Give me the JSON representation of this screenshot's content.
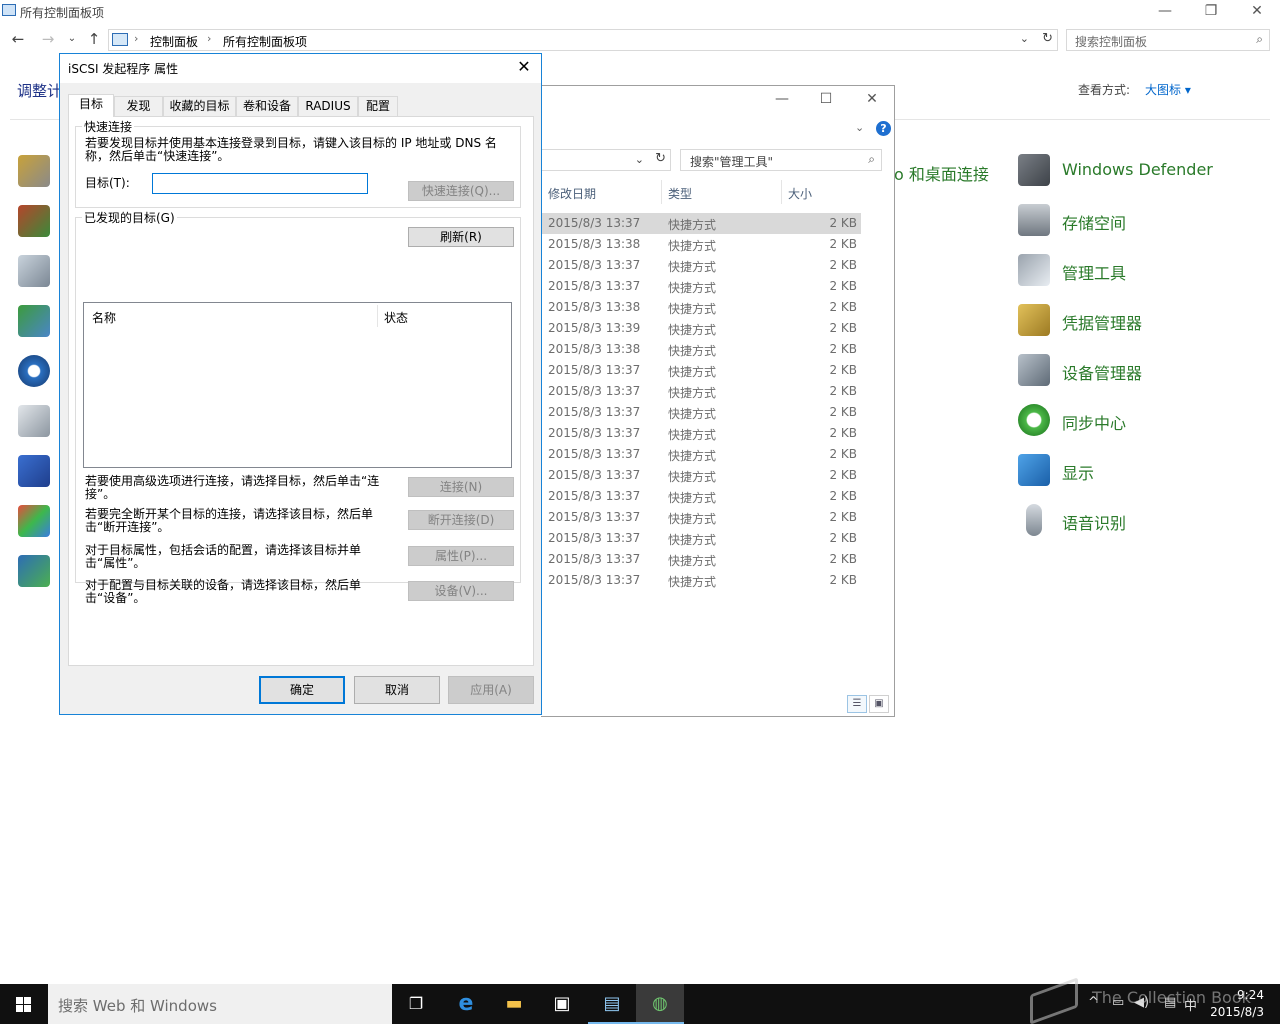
{
  "control_panel": {
    "window_title": "所有控制面板项",
    "breadcrumb": [
      "控制面板",
      "所有控制面板项"
    ],
    "search_placeholder": "搜索控制面板",
    "heading": "调整计",
    "view_by_label": "查看方式:",
    "view_by_value": "大图标 ▾",
    "partial_item": "o 和桌面连接",
    "items": [
      {
        "label": "Windows Defender",
        "icon": "windows-defender-icon"
      },
      {
        "label": "存储空间",
        "icon": "storage-spaces-icon"
      },
      {
        "label": "管理工具",
        "icon": "admin-tools-icon"
      },
      {
        "label": "凭据管理器",
        "icon": "credential-manager-icon"
      },
      {
        "label": "设备管理器",
        "icon": "device-manager-icon"
      },
      {
        "label": "同步中心",
        "icon": "sync-center-icon"
      },
      {
        "label": "显示",
        "icon": "display-icon"
      },
      {
        "label": "语音识别",
        "icon": "speech-recognition-icon"
      }
    ]
  },
  "explorer": {
    "search_placeholder": "搜索\"管理工具\"",
    "columns": {
      "date": "修改日期",
      "type": "类型",
      "size": "大小"
    },
    "rows": [
      {
        "date": "2015/8/3 13:37",
        "type": "快捷方式",
        "size": "2 KB"
      },
      {
        "date": "2015/8/3 13:38",
        "type": "快捷方式",
        "size": "2 KB"
      },
      {
        "date": "2015/8/3 13:37",
        "type": "快捷方式",
        "size": "2 KB"
      },
      {
        "date": "2015/8/3 13:37",
        "type": "快捷方式",
        "size": "2 KB"
      },
      {
        "date": "2015/8/3 13:38",
        "type": "快捷方式",
        "size": "2 KB"
      },
      {
        "date": "2015/8/3 13:39",
        "type": "快捷方式",
        "size": "2 KB"
      },
      {
        "date": "2015/8/3 13:38",
        "type": "快捷方式",
        "size": "2 KB"
      },
      {
        "date": "2015/8/3 13:37",
        "type": "快捷方式",
        "size": "2 KB"
      },
      {
        "date": "2015/8/3 13:37",
        "type": "快捷方式",
        "size": "2 KB"
      },
      {
        "date": "2015/8/3 13:37",
        "type": "快捷方式",
        "size": "2 KB"
      },
      {
        "date": "2015/8/3 13:37",
        "type": "快捷方式",
        "size": "2 KB"
      },
      {
        "date": "2015/8/3 13:37",
        "type": "快捷方式",
        "size": "2 KB"
      },
      {
        "date": "2015/8/3 13:37",
        "type": "快捷方式",
        "size": "2 KB"
      },
      {
        "date": "2015/8/3 13:37",
        "type": "快捷方式",
        "size": "2 KB"
      },
      {
        "date": "2015/8/3 13:37",
        "type": "快捷方式",
        "size": "2 KB"
      },
      {
        "date": "2015/8/3 13:37",
        "type": "快捷方式",
        "size": "2 KB"
      },
      {
        "date": "2015/8/3 13:37",
        "type": "快捷方式",
        "size": "2 KB"
      },
      {
        "date": "2015/8/3 13:37",
        "type": "快捷方式",
        "size": "2 KB"
      }
    ]
  },
  "dialog": {
    "title": "iSCSI 发起程序 属性",
    "tabs": [
      "目标",
      "发现",
      "收藏的目标",
      "卷和设备",
      "RADIUS",
      "配置"
    ],
    "quick_connect": {
      "group_label": "快速连接",
      "description": "若要发现目标并使用基本连接登录到目标，请键入该目标的 IP 地址或 DNS 名称，然后单击“快速连接”。",
      "target_label": "目标(T):",
      "target_value": "",
      "quick_connect_button": "快速连接(Q)..."
    },
    "discovered": {
      "group_label": "已发现的目标(G)",
      "refresh_button": "刷新(R)",
      "col_name": "名称",
      "col_status": "状态"
    },
    "actions": [
      {
        "text": "若要使用高级选项进行连接，请选择目标，然后单击“连接”。",
        "button": "连接(N)"
      },
      {
        "text": "若要完全断开某个目标的连接，请选择该目标，然后单击“断开连接”。",
        "button": "断开连接(D)"
      },
      {
        "text": "对于目标属性，包括会话的配置，请选择该目标并单击“属性”。",
        "button": "属性(P)..."
      },
      {
        "text": "对于配置与目标关联的设备，请选择该目标，然后单击“设备”。",
        "button": "设备(V)..."
      }
    ],
    "ok": "确定",
    "cancel": "取消",
    "apply": "应用(A)"
  },
  "taskbar": {
    "search_placeholder": "搜索 Web 和 Windows",
    "time": "9:24",
    "date": "2015/8/3",
    "ime": "中",
    "watermark": "The Collection Book"
  },
  "colors": {
    "accent": "#0078d7",
    "link_green": "#2a7a2a",
    "taskbar": "#101010"
  }
}
